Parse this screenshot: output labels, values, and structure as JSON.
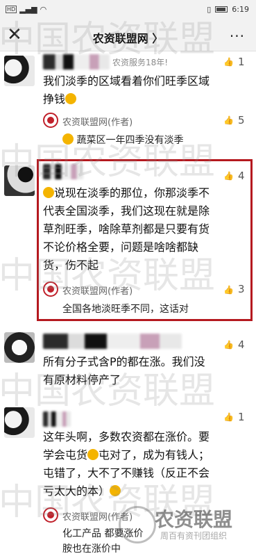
{
  "status_bar": {
    "network": "HD",
    "time": "6:19"
  },
  "nav": {
    "close": "✕",
    "title": "农资联盟网 〉",
    "more": "···"
  },
  "comments": [
    {
      "name_visible": "农资服务18年!",
      "likes": "1",
      "text_lines": [
        "我们淡季的区域看着你们旺季区域",
        "挣钱"
      ],
      "reply": {
        "author": "农资联盟网(作者)",
        "likes": "5",
        "text": "蔬菜区一年四季没有淡季"
      }
    },
    {
      "name_visible": "",
      "likes": "4",
      "highlighted": true,
      "text_lines": [
        "说现在淡季的那位，你那淡季不",
        "代表全国淡季，我们这现在就是除",
        "草剂旺季，啥除草剂都是只要有货",
        "不论价格全要，问题是啥啥都缺",
        "货，伤不起"
      ],
      "reply": {
        "author": "农资联盟网(作者)",
        "likes": "3",
        "text": "全国各地淡旺季不同，这话对"
      }
    },
    {
      "name_visible": "",
      "likes": "4",
      "text_lines": [
        "所有分子式含P的都在涨。我们没",
        "有原材料停产了"
      ]
    },
    {
      "name_visible": "",
      "likes": "1",
      "text_lines": [
        "这年头啊，多数农资都在涨价。要",
        "学会屯货",
        "屯对了，成为有钱人；",
        "屯错了，大不了不赚钱（反正不会",
        "亏太大的本）"
      ],
      "reply": {
        "author": "农资联盟网(作者)",
        "likes": "",
        "text_lines": [
          "化工产品 都要涨价",
          "胺也在涨价中"
        ]
      }
    }
  ],
  "watermark": {
    "text": "中国农资联盟",
    "logo_title": "农资联盟",
    "logo_sub": "周百有资刊团组织"
  }
}
